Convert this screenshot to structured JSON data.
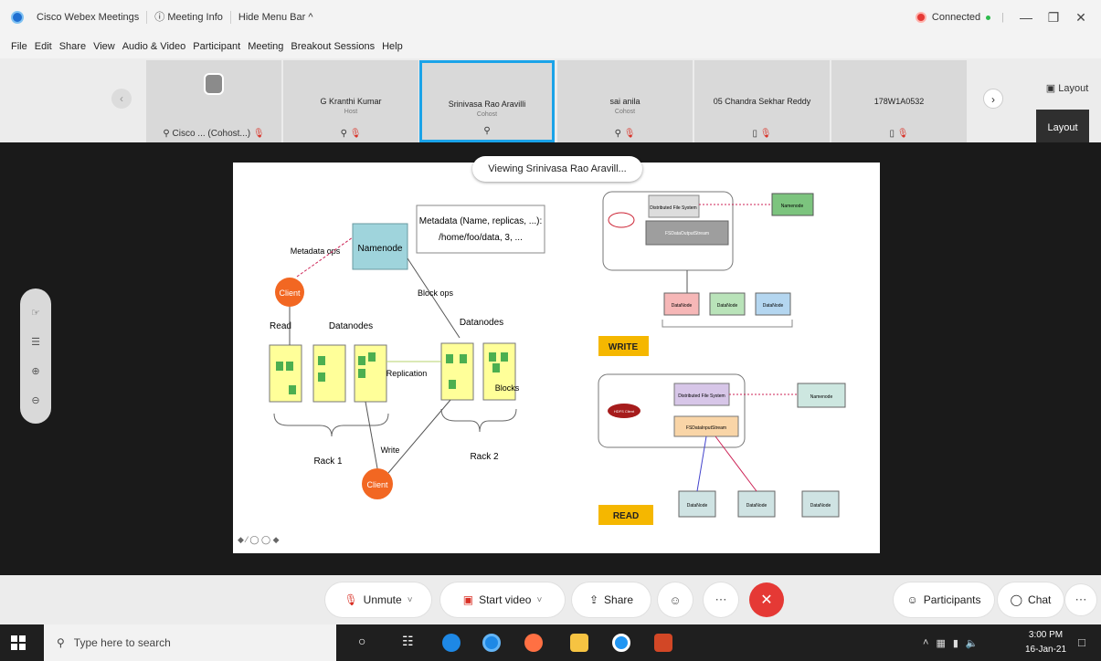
{
  "titlebar": {
    "app": "Cisco Webex Meetings",
    "meeting_info": "ⓘ Meeting Info",
    "hide_menu": "Hide Menu Bar ^",
    "status": "Connected"
  },
  "menu": [
    "File",
    "Edit",
    "Share",
    "View",
    "Audio & Video",
    "Participant",
    "Meeting",
    "Breakout Sessions",
    "Help"
  ],
  "participants": [
    {
      "name": "",
      "role": "",
      "footer": "Cisco ... (Cohost...)"
    },
    {
      "name": "G Kranthi Kumar",
      "role": "Host",
      "footer": ""
    },
    {
      "name": "Srinivasa Rao Aravilli",
      "role": "Cohost",
      "footer": ""
    },
    {
      "name": "sai anila",
      "role": "Cohost",
      "footer": ""
    },
    {
      "name": "05 Chandra Sekhar Reddy",
      "role": "",
      "footer": ""
    },
    {
      "name": "178W1A0532",
      "role": "",
      "footer": ""
    }
  ],
  "layout_label": "Layout",
  "layout_box_label": "Layout",
  "viewing_label": "Viewing Srinivasa Rao Aravill...",
  "slide": {
    "metadata_ops": "Metadata ops",
    "namenode": "Namenode",
    "metadata_box_line1": "Metadata (Name, replicas, ...):",
    "metadata_box_line2": "/home/foo/data, 3, ...",
    "block_ops": "Block ops",
    "client": "Client",
    "read": "Read",
    "datanodes_left": "Datanodes",
    "datanodes_right": "Datanodes",
    "replication": "Replication",
    "blocks": "Blocks",
    "write": "Write",
    "rack1": "Rack 1",
    "rack2": "Rack 2",
    "write_label": "WRITE",
    "read_label": "READ",
    "w_dfs": "Distributed File System",
    "w_fsout": "FSDataOutputStream",
    "w_namenode": "Namenode",
    "w_datanode1": "DataNode",
    "w_datanode2": "DataNode",
    "w_datanode3": "DataNode",
    "r_dfs": "Distributed File System",
    "r_fsin": "FSDataInputStream",
    "r_namenode": "Namenode",
    "r_client": "HDFS Client",
    "r_datanode1": "DataNode",
    "r_datanode2": "DataNode",
    "r_datanode3": "DataNode"
  },
  "controls": {
    "unmute": "Unmute",
    "start_video": "Start video",
    "share": "Share",
    "participants": "Participants",
    "chat": "Chat"
  },
  "taskbar": {
    "search_placeholder": "Type here to search",
    "time": "3:00 PM",
    "date": "16-Jan-21"
  }
}
